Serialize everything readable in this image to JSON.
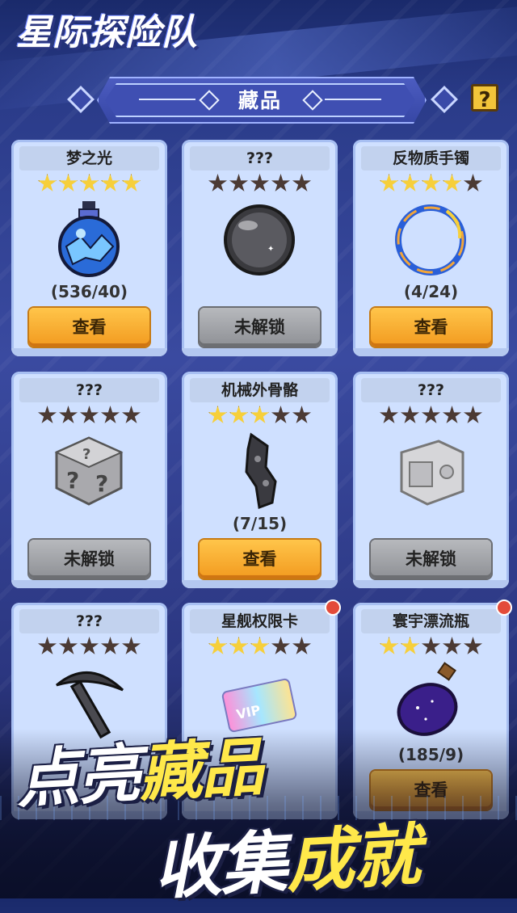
{
  "app_title": "星际探险队",
  "header": {
    "title": "藏品",
    "help_label": "?"
  },
  "cards": [
    {
      "name": "梦之光",
      "stars_on": 5,
      "art": "glowing-potion-orb",
      "progress": "(536/40)",
      "button": "查看",
      "state": "unlocked",
      "badge": false
    },
    {
      "name": "???",
      "stars_on": 0,
      "art": "dark-sphere",
      "progress": "",
      "button": "未解锁",
      "state": "locked",
      "badge": false
    },
    {
      "name": "反物质手镯",
      "stars_on": 4,
      "art": "energy-bracelet",
      "progress": "(4/24)",
      "button": "查看",
      "state": "unlocked",
      "badge": false
    },
    {
      "name": "???",
      "stars_on": 0,
      "art": "mystery-box",
      "progress": "",
      "button": "未解锁",
      "state": "locked",
      "badge": false
    },
    {
      "name": "机械外骨骼",
      "stars_on": 3,
      "art": "mech-exoskeleton",
      "progress": "(7/15)",
      "button": "查看",
      "state": "unlocked",
      "badge": false
    },
    {
      "name": "???",
      "stars_on": 0,
      "art": "machine-crate",
      "progress": "",
      "button": "未解锁",
      "state": "locked",
      "badge": false
    },
    {
      "name": "???",
      "stars_on": 0,
      "art": "pickaxe",
      "progress": "",
      "button": "",
      "state": "locked",
      "badge": false
    },
    {
      "name": "星舰权限卡",
      "stars_on": 3,
      "art": "vip-card",
      "progress": "",
      "button": "",
      "state": "unlocked",
      "badge": true
    },
    {
      "name": "寰宇漂流瓶",
      "stars_on": 2,
      "art": "star-bottle",
      "progress": "(185/9)",
      "button": "查看",
      "state": "unlocked",
      "badge": true
    }
  ],
  "slogan": {
    "line1_a": "点亮",
    "line1_b": "藏品",
    "line2_a": "收集",
    "line2_b": "成就"
  },
  "colors": {
    "accent_gold": "#f6cf3b",
    "button_orange": "#f29a1f",
    "locked_gray": "#8e9095",
    "card_bg": "#cfe0ff"
  }
}
